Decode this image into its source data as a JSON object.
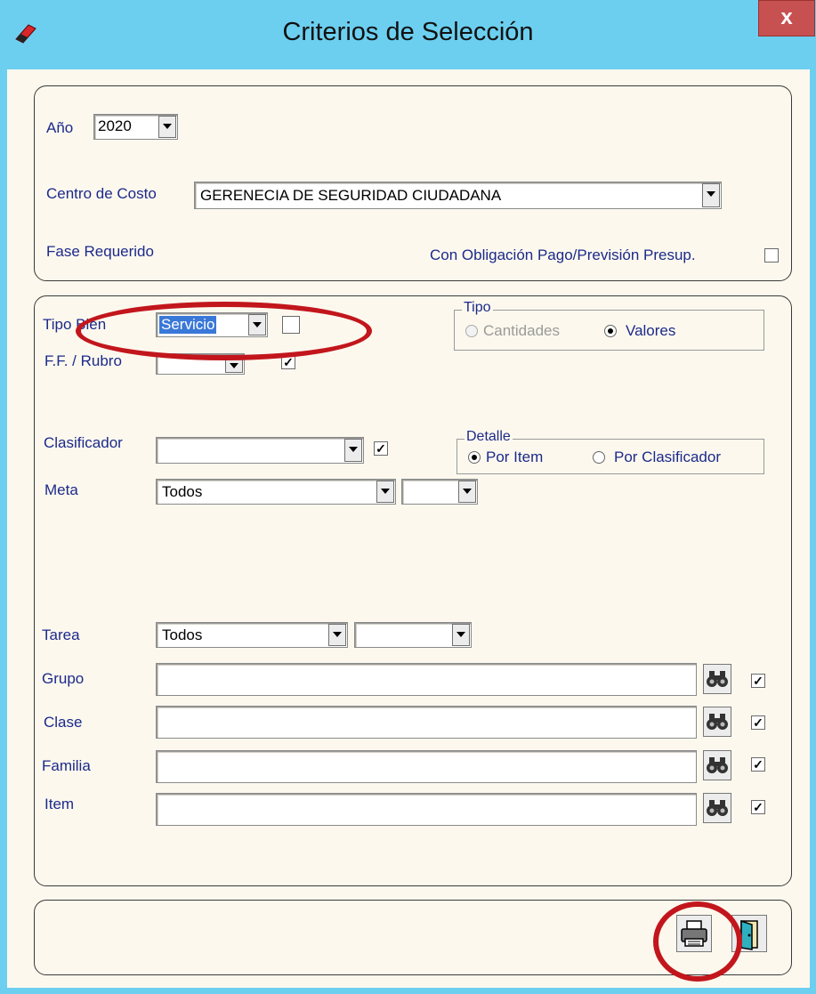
{
  "window": {
    "title": "Criterios de Selección",
    "close_label": "x"
  },
  "top": {
    "anio_label": "Año",
    "anio_value": "2020",
    "centro_label": "Centro de Costo",
    "centro_value": "GERENECIA DE SEGURIDAD CIUDADANA",
    "fase_label": "Fase Requerido",
    "obligacion_label": "Con Obligación Pago/Previsión Presup.",
    "obligacion_checked": false
  },
  "middle": {
    "tipo_bien_label": "Tipo Bien",
    "tipo_bien_value": "Servicio",
    "tipo_bien_checked": false,
    "ff_label": "F.F. / Rubro",
    "ff_value": "",
    "ff_checked": true,
    "tipo_group": {
      "title": "Tipo",
      "opt1": "Cantidades",
      "opt2": "Valores",
      "selected": "Valores"
    },
    "clasificador_label": "Clasificador",
    "clasificador_value": "",
    "clasificador_checked": true,
    "detalle_group": {
      "title": "Detalle",
      "opt1": "Por Item",
      "opt2": "Por Clasificador",
      "selected": "Por Item"
    },
    "meta_label": "Meta",
    "meta_value": "Todos",
    "meta_value2": "",
    "tarea_label": "Tarea",
    "tarea_value": "Todos",
    "tarea_value2": "",
    "rows": [
      {
        "label": "Grupo",
        "value": "",
        "checked": true
      },
      {
        "label": "Clase",
        "value": "",
        "checked": true
      },
      {
        "label": "Familia",
        "value": "",
        "checked": true
      },
      {
        "label": "Item",
        "value": "",
        "checked": true
      }
    ]
  },
  "icons": {
    "app": "eraser-icon",
    "find": "binoculars-icon",
    "print": "printer-icon",
    "exit": "exit-door-icon"
  },
  "colors": {
    "titlebar": "#6ccff0",
    "panel": "#fcf8ee",
    "label": "#1c2a8a",
    "highlight": "#c2161c",
    "close": "#c75050"
  }
}
